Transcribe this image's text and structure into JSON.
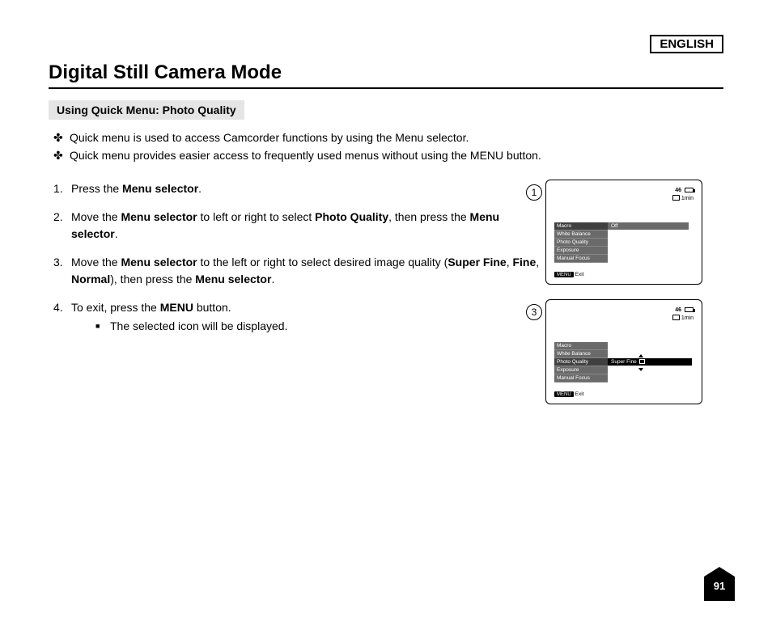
{
  "language": "ENGLISH",
  "title": "Digital Still Camera Mode",
  "subhead": "Using Quick Menu: Photo Quality",
  "bullets": [
    "Quick menu is used to access Camcorder functions by using the Menu selector.",
    "Quick menu provides easier access to frequently used menus without using the MENU button."
  ],
  "steps": {
    "s1_a": "Press the ",
    "s1_b": "Menu selector",
    "s1_c": ".",
    "s2_a": "Move the ",
    "s2_b": "Menu selector",
    "s2_c": " to left or right to select ",
    "s2_d": "Photo Quality",
    "s2_e": ", then press the ",
    "s2_f": "Menu selector",
    "s2_g": ".",
    "s3_a": "Move the ",
    "s3_b": "Menu selector",
    "s3_c": " to the left or right to select desired image quality (",
    "s3_d": "Super Fine",
    "s3_e": ", ",
    "s3_f": "Fine",
    "s3_g": ", ",
    "s3_h": "Normal",
    "s3_i": "), then press the ",
    "s3_j": "Menu selector",
    "s3_k": ".",
    "s4_a": "To exit, press the ",
    "s4_b": "MENU",
    "s4_c": " button.",
    "s4_sub": "The selected icon will be displayed."
  },
  "fig": {
    "num1": "1",
    "num3": "3",
    "count": "46",
    "time": "1min",
    "menu_items": [
      "Macro",
      "White Balance",
      "Photo Quality",
      "Exposure",
      "Manual Focus"
    ],
    "val_off": "Off",
    "val_sf": "Super Fine",
    "menu_btn": "MENU",
    "exit": "Exit"
  },
  "page_number": "91"
}
